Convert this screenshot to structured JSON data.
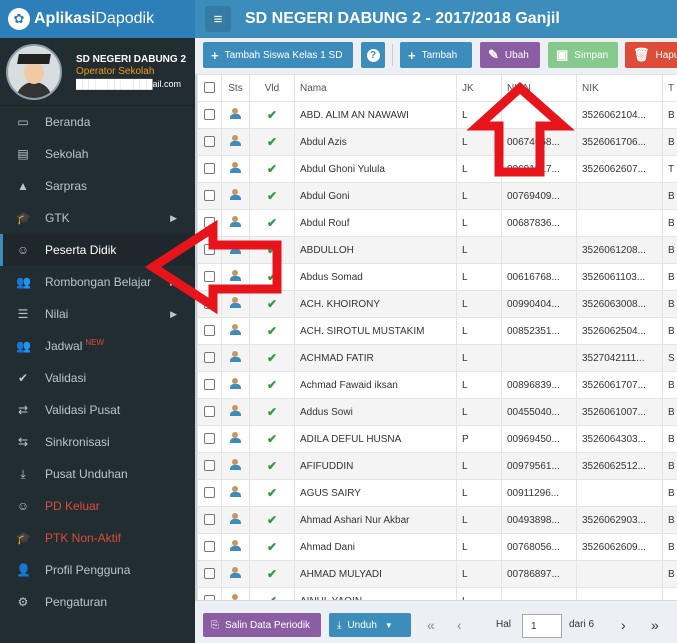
{
  "brand": {
    "bold": "Aplikasi",
    "light": "Dapodik"
  },
  "page_title": "SD NEGERI DABUNG 2 - 2017/2018 Ganjil",
  "user": {
    "name": "SD NEGERI DABUNG 2",
    "role": "Operator Sekolah",
    "email": "████████████ail.com"
  },
  "menu": [
    {
      "label": "Beranda",
      "icon": "desktop-icon",
      "glyph": "▭",
      "arrow": false
    },
    {
      "label": "Sekolah",
      "icon": "building-icon",
      "glyph": "▤",
      "arrow": false
    },
    {
      "label": "Sarpras",
      "icon": "road-icon",
      "glyph": "▲",
      "arrow": false
    },
    {
      "label": "GTK",
      "icon": "graduation-cap-icon",
      "glyph": "🎓",
      "arrow": true
    },
    {
      "label": "Peserta Didik",
      "icon": "smile-icon",
      "glyph": "☺",
      "arrow": false,
      "active": true
    },
    {
      "label": "Rombongan Belajar",
      "icon": "users-icon",
      "glyph": "👥",
      "arrow": true
    },
    {
      "label": "Nilai",
      "icon": "list-icon",
      "glyph": "☰",
      "arrow": true
    },
    {
      "label": "Jadwal",
      "icon": "users-icon",
      "glyph": "👥",
      "arrow": false,
      "badge": "NEW"
    },
    {
      "label": "Validasi",
      "icon": "check-icon",
      "glyph": "✔",
      "arrow": false
    },
    {
      "label": "Validasi Pusat",
      "icon": "retweet-icon",
      "glyph": "⇄",
      "arrow": false
    },
    {
      "label": "Sinkronisasi",
      "icon": "exchange-icon",
      "glyph": "⇆",
      "arrow": false
    },
    {
      "label": "Pusat Unduhan",
      "icon": "download-icon",
      "glyph": "⤓",
      "arrow": false
    },
    {
      "label": "PD Keluar",
      "icon": "smile-icon",
      "glyph": "☺",
      "arrow": false,
      "red": true
    },
    {
      "label": "PTK Non-Aktif",
      "icon": "graduation-cap-icon",
      "glyph": "🎓",
      "arrow": false,
      "red": true
    },
    {
      "label": "Profil Pengguna",
      "icon": "user-icon",
      "glyph": "👤",
      "arrow": false
    },
    {
      "label": "Pengaturan",
      "icon": "gear-icon",
      "glyph": "⚙",
      "arrow": false
    }
  ],
  "toolbar": {
    "add_class1": "Tambah Siswa Kelas 1 SD",
    "help": "?",
    "add": "Tambah",
    "edit": "Ubah",
    "save": "Simpan",
    "delete": "Hapus"
  },
  "table": {
    "headers": {
      "sts": "Sts",
      "vld": "Vld",
      "nama": "Nama",
      "jk": "JK",
      "nisn": "NISN",
      "nik": "NIK",
      "tempat": "T"
    },
    "rows": [
      {
        "nama": "ABD. ALIM AN NAWAWI",
        "jk": "L",
        "nisn": "",
        "nik": "3526062104...",
        "tempat": "B"
      },
      {
        "nama": "Abdul Azis",
        "jk": "L",
        "nisn": "00674668...",
        "nik": "3526061706...",
        "tempat": "B"
      },
      {
        "nama": "Abdul Ghoni Yulula",
        "jk": "L",
        "nisn": "00691917...",
        "nik": "3526062607...",
        "tempat": "T"
      },
      {
        "nama": "Abdul Goni",
        "jk": "L",
        "nisn": "00769409...",
        "nik": "",
        "tempat": "B"
      },
      {
        "nama": "Abdul Rouf",
        "jk": "L",
        "nisn": "00687836...",
        "nik": "",
        "tempat": "B"
      },
      {
        "nama": "ABDULLOH",
        "jk": "L",
        "nisn": "",
        "nik": "3526061208...",
        "tempat": "B"
      },
      {
        "nama": "Abdus Somad",
        "jk": "L",
        "nisn": "00616768...",
        "nik": "3526061103...",
        "tempat": "B"
      },
      {
        "nama": "ACH. KHOIRONY",
        "jk": "L",
        "nisn": "00990404...",
        "nik": "3526063008...",
        "tempat": "B"
      },
      {
        "nama": "ACH. SIROTUL MUSTAKIM",
        "jk": "L",
        "nisn": "00852351...",
        "nik": "3526062504...",
        "tempat": "B"
      },
      {
        "nama": "ACHMAD FATIR",
        "jk": "L",
        "nisn": "",
        "nik": "3527042111...",
        "tempat": "S"
      },
      {
        "nama": "Achmad Fawaid iksan",
        "jk": "L",
        "nisn": "00896839...",
        "nik": "3526061707...",
        "tempat": "B"
      },
      {
        "nama": "Addus Sowi",
        "jk": "L",
        "nisn": "00455040...",
        "nik": "3526061007...",
        "tempat": "B"
      },
      {
        "nama": "ADILA DEFUL HUSNA",
        "jk": "P",
        "nisn": "00969450...",
        "nik": "3526064303...",
        "tempat": "B"
      },
      {
        "nama": "AFIFUDDIN",
        "jk": "L",
        "nisn": "00979561...",
        "nik": "3526062512...",
        "tempat": "B"
      },
      {
        "nama": "AGUS SAIRY",
        "jk": "L",
        "nisn": "00911296...",
        "nik": "",
        "tempat": "B"
      },
      {
        "nama": "Ahmad Ashari Nur Akbar",
        "jk": "L",
        "nisn": "00493898...",
        "nik": "3526062903...",
        "tempat": "B"
      },
      {
        "nama": "Ahmad Dani",
        "jk": "L",
        "nisn": "00768056...",
        "nik": "3526062609...",
        "tempat": "B"
      },
      {
        "nama": "AHMAD MULYADI",
        "jk": "L",
        "nisn": "00786897...",
        "nik": "",
        "tempat": "B"
      },
      {
        "nama": "AINUL YAQIN",
        "jk": "L",
        "nisn": "",
        "nik": "",
        "tempat": ""
      }
    ]
  },
  "pager": {
    "salin": "Salin Data Periodik",
    "unduh": "Unduh",
    "hal_label": "Hal",
    "page": "1",
    "of_label": "dari 6"
  },
  "colors": {
    "header": "#3c8dbc",
    "sidebar": "#222d32",
    "annotation_arrow": "#e8141b"
  }
}
